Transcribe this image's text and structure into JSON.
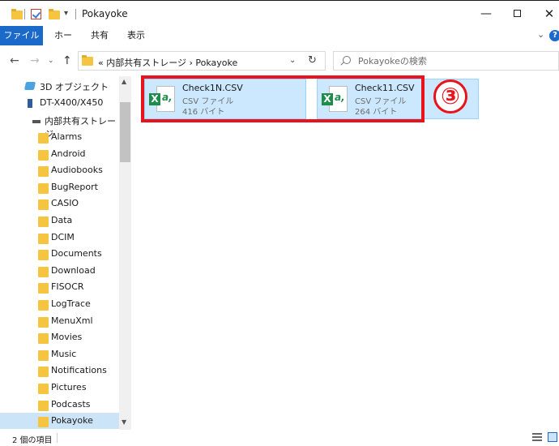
{
  "window": {
    "title": "Pokayoke",
    "min_glyph": "—",
    "close_glyph": "✕"
  },
  "ribbon": {
    "tabs": [
      "ファイル",
      "ホーム",
      "共有",
      "表示"
    ],
    "collapse_glyph": "⌄",
    "help_glyph": "?"
  },
  "addressbar": {
    "back_glyph": "←",
    "forward_glyph": "→",
    "recent_glyph": "⌄",
    "up_glyph": "↑",
    "path": "« 内部共有ストレージ › Pokayoke",
    "dropdown_glyph": "⌄",
    "refresh_glyph": "↻"
  },
  "search": {
    "placeholder": "Pokayokeの検索"
  },
  "navpane": {
    "this_pc_3d": "3D オブジェクト",
    "device": "DT-X400/X450",
    "internal_storage": "内部共有ストレージ",
    "folders": [
      "Alarms",
      "Android",
      "Audiobooks",
      "BugReport",
      "CASIO",
      "Data",
      "DCIM",
      "Documents",
      "Download",
      "FISOCR",
      "LogTrace",
      "MenuXml",
      "Movies",
      "Music",
      "Notifications",
      "Pictures",
      "Podcasts",
      "Pokayoke"
    ],
    "selected": "Pokayoke",
    "scroll_up_glyph": "▲",
    "scroll_down_glyph": "▼"
  },
  "files": [
    {
      "name": "Check1N.CSV",
      "type": "CSV ファイル",
      "size": "416 バイト",
      "icon": "excel-csv-icon"
    },
    {
      "name": "Check11.CSV",
      "type": "CSV ファイル",
      "size": "264 バイト",
      "icon": "excel-csv-icon"
    }
  ],
  "annotation": {
    "step": "③",
    "color": "#e8131b"
  },
  "status": {
    "count": "2 個の項目"
  },
  "colors": {
    "accent": "#1b6ac9",
    "selection": "#cce8ff",
    "excel": "#1e8d4c"
  }
}
